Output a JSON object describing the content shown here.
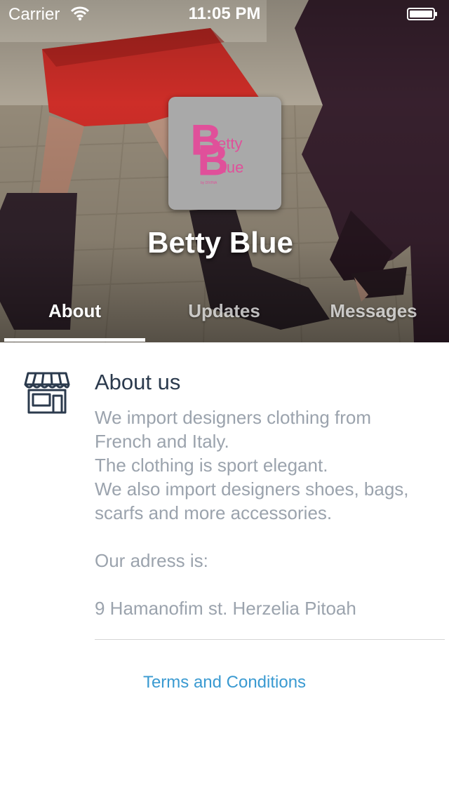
{
  "status_bar": {
    "carrier": "Carrier",
    "time": "11:05 PM",
    "wifi_icon": "wifi-icon",
    "battery_icon": "battery-icon"
  },
  "header": {
    "business_name": "Betty Blue",
    "logo": {
      "text_line1": "etty",
      "text_line2": "lue",
      "initials": "BB",
      "tagline": "by DIVINA",
      "color": "#e0509a",
      "background": "#a9a9a9"
    }
  },
  "tabs": [
    {
      "label": "About",
      "active": true
    },
    {
      "label": "Updates",
      "active": false
    },
    {
      "label": "Messages",
      "active": false
    }
  ],
  "about": {
    "icon": "storefront-icon",
    "heading": "About us",
    "lines": [
      "We import designers clothing from",
      "French and Italy.",
      "The clothing is sport elegant.",
      "We also import designers shoes, bags,",
      "scarfs and more accessories.",
      "",
      "Our adress is:",
      "",
      "9 Hamanofim st. Herzelia Pitoah"
    ]
  },
  "footer": {
    "terms_label": "Terms and Conditions"
  },
  "colors": {
    "accent_link": "#3a9ad1",
    "heading": "#2b3a4d",
    "body_text": "#9ba3ad"
  }
}
